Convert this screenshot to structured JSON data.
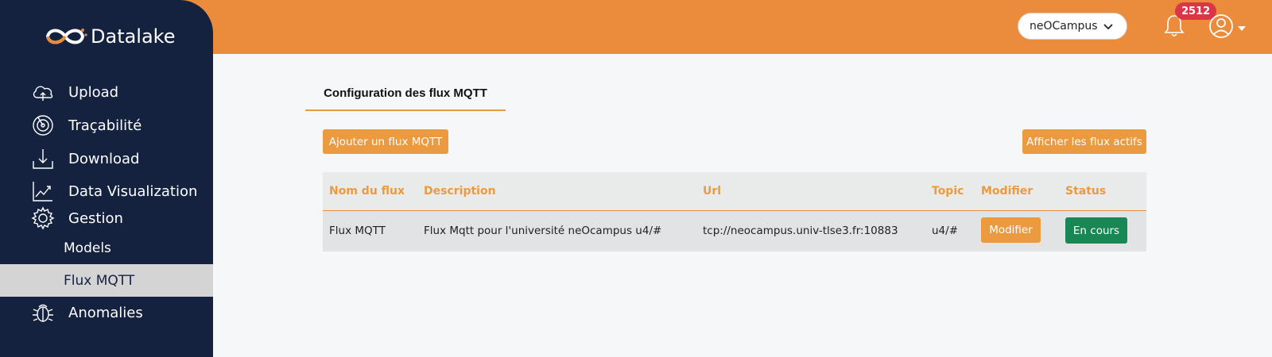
{
  "brand": {
    "name": "Datalake"
  },
  "sidebar": {
    "items": [
      {
        "label": "Upload",
        "icon": "cloud-upload-icon"
      },
      {
        "label": "Traçabilité",
        "icon": "radar-icon"
      },
      {
        "label": "Download",
        "icon": "download-icon"
      },
      {
        "label": "Data Visualization",
        "icon": "chart-icon"
      },
      {
        "label": "Gestion",
        "icon": "gear-icon"
      }
    ],
    "sub_items": [
      {
        "label": "Models",
        "active": false
      },
      {
        "label": "Flux MQTT",
        "active": true
      }
    ],
    "anomalies": {
      "label": "Anomalies",
      "icon": "bug-icon"
    }
  },
  "header": {
    "org_select": {
      "value": "neOCampus"
    },
    "notifications": {
      "count": "2512"
    }
  },
  "main": {
    "tab": "Configuration des flux MQTT",
    "add_button": "Ajouter un flux MQTT",
    "active_button": "Afficher les flux actifs",
    "table": {
      "columns": [
        "Nom du flux",
        "Description",
        "Url",
        "Topic",
        "Modifier",
        "Status"
      ],
      "rows": [
        {
          "name": "Flux MQTT",
          "description": "Flux Mqtt pour l'université neOcampus u4/#",
          "url": "tcp://neocampus.univ-tlse3.fr:10883",
          "topic": "u4/#",
          "modify_label": "Modifier",
          "status": "En cours"
        }
      ]
    }
  },
  "colors": {
    "header": "#eb8c3c",
    "sidebar": "#142240",
    "accent_button": "#eb9a3f",
    "status_active": "#198754",
    "badge": "#dc3545"
  }
}
